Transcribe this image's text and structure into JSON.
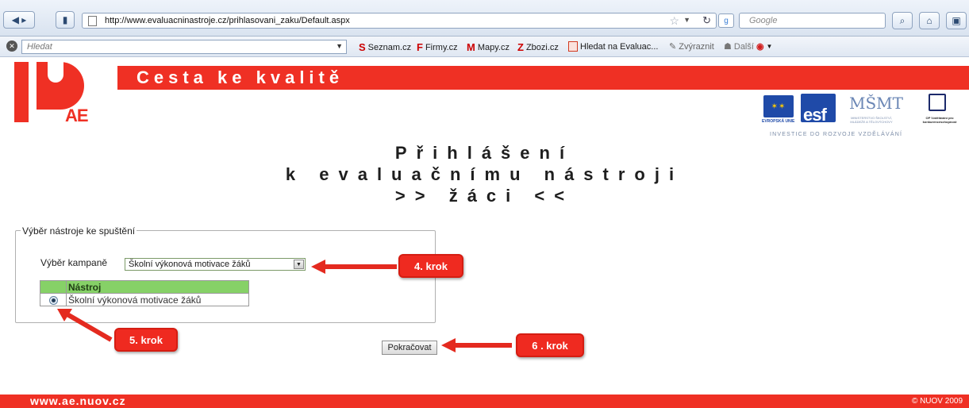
{
  "browser": {
    "url": "http://www.evaluacninastroje.cz/prihlasovani_zaku/Default.aspx",
    "search_placeholder": "Google",
    "hledat_placeholder": "Hledat",
    "bookmarks": [
      {
        "label": "Seznam.cz",
        "icon": "S"
      },
      {
        "label": "Firmy.cz",
        "icon": "F"
      },
      {
        "label": "Mapy.cz",
        "icon": "M"
      },
      {
        "label": "Zbozi.cz",
        "icon": "Z"
      },
      {
        "label": "Hledat na Evaluac...",
        "icon": "document-icon"
      },
      {
        "label": "Zvýraznit",
        "icon": "pen-icon"
      },
      {
        "label": "Další",
        "icon": "people-icon"
      }
    ]
  },
  "banner": {
    "title": "Cesta ke kvalitě",
    "logo_text": "AE",
    "investice": "INVESTICE DO ROZVOJE VZDĚLÁVÁNÍ",
    "eu_caption": "EVROPSKÁ UNIE",
    "esf_text": "esf",
    "msmt_text": "MŠMT",
    "msmt_caption": "MINISTERSTVO ŠKOLSTVÍ, MLÁDEŽE A TĚLOVÝCHOVY",
    "op_caption": "OP Vzdělávání pro konkurenceschopnost"
  },
  "heading": {
    "line1": "Přihlášení",
    "line2": "k evaluačnímu nástroji",
    "line3": ">> žáci <<"
  },
  "form": {
    "legend": "Výběr nástroje ke spuštění",
    "campaign_label": "Výběr kampaně",
    "campaign_value": "Školní výkonová motivace žáků",
    "table_header": "Nástroj",
    "table_rows": [
      "Školní výkonová motivace žáků"
    ],
    "continue_label": "Pokračovat"
  },
  "callouts": {
    "step4": "4. krok",
    "step5": "5. krok",
    "step6": "6 . krok"
  },
  "footer": {
    "url": "www.ae.nuov.cz",
    "copyright": "© NUOV 2009"
  },
  "colors": {
    "brand_red": "#ef3024",
    "table_header_green": "#86d167"
  }
}
